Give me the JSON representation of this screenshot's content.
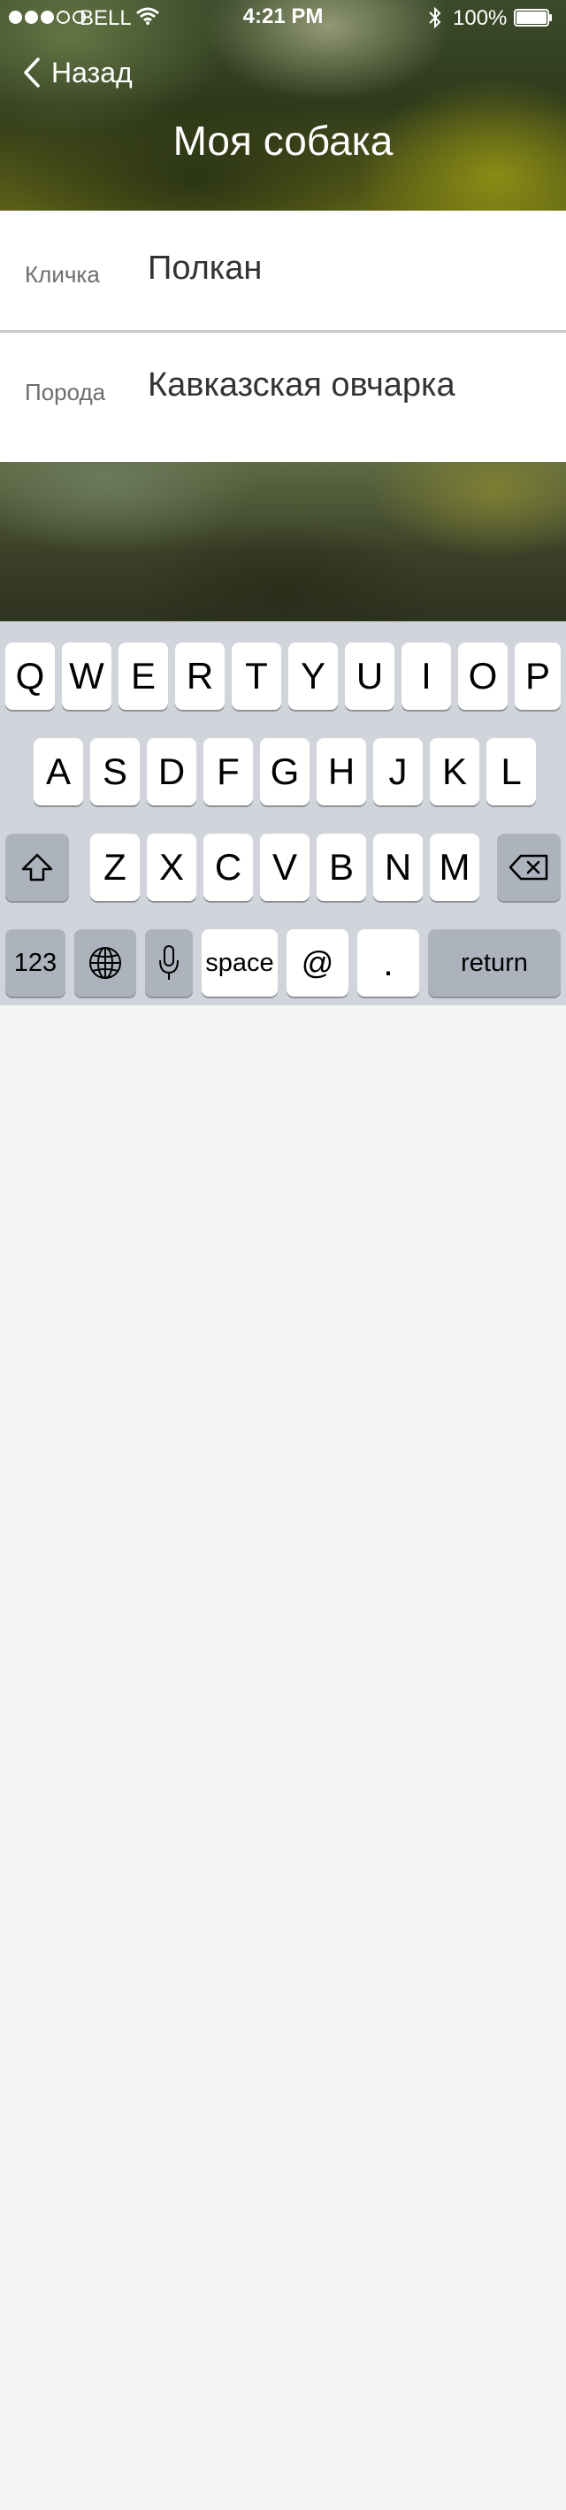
{
  "status_bar": {
    "carrier": "BELL",
    "time": "4:21 PM",
    "battery": "100%"
  },
  "nav": {
    "back_label": "Назад",
    "title": "Моя собака"
  },
  "form": {
    "name": {
      "label": "Кличка",
      "value": "Полкан"
    },
    "breed": {
      "label": "Порода",
      "value": "Кавказская овчарка"
    }
  },
  "keyboard": {
    "row1": [
      "Q",
      "W",
      "E",
      "R",
      "T",
      "Y",
      "U",
      "I",
      "O",
      "P"
    ],
    "row2": [
      "A",
      "S",
      "D",
      "F",
      "G",
      "H",
      "J",
      "K",
      "L"
    ],
    "row3": [
      "Z",
      "X",
      "C",
      "V",
      "B",
      "N",
      "M"
    ],
    "numbers_label": "123",
    "space_label": "space",
    "at_label": "@",
    "period_label": ".",
    "return_label": "return"
  },
  "icons": {
    "signal": "signal-dots-icon",
    "wifi": "wifi-icon",
    "bluetooth": "bluetooth-icon",
    "battery": "battery-icon",
    "back": "chevron-left-icon",
    "shift": "shift-icon",
    "delete": "backspace-icon",
    "globe": "globe-icon",
    "mic": "microphone-icon"
  },
  "colors": {
    "keyboard_bg": "#d1d5db",
    "key_bg": "#ffffff",
    "key_gray": "#acb3bc",
    "label_gray": "#6d6d72"
  }
}
